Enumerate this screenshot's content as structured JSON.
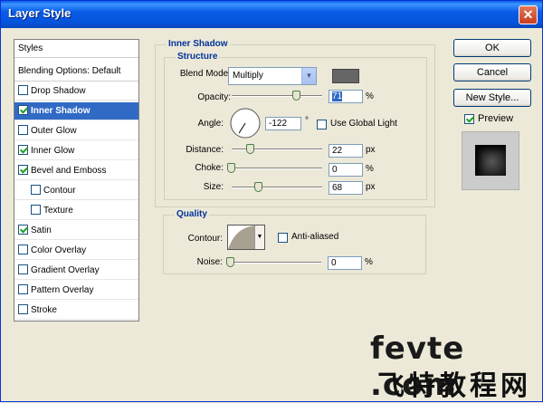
{
  "window": {
    "title": "Layer Style",
    "close_glyph": "✕"
  },
  "styles_panel": {
    "header": "Styles",
    "blending": "Blending Options: Default",
    "items": [
      {
        "label": "Drop Shadow",
        "checked": false,
        "selected": false,
        "indent": false
      },
      {
        "label": "Inner Shadow",
        "checked": true,
        "selected": true,
        "indent": false
      },
      {
        "label": "Outer Glow",
        "checked": false,
        "selected": false,
        "indent": false
      },
      {
        "label": "Inner Glow",
        "checked": true,
        "selected": false,
        "indent": false
      },
      {
        "label": "Bevel and Emboss",
        "checked": true,
        "selected": false,
        "indent": false
      },
      {
        "label": "Contour",
        "checked": false,
        "selected": false,
        "indent": true
      },
      {
        "label": "Texture",
        "checked": false,
        "selected": false,
        "indent": true
      },
      {
        "label": "Satin",
        "checked": true,
        "selected": false,
        "indent": false
      },
      {
        "label": "Color Overlay",
        "checked": false,
        "selected": false,
        "indent": false
      },
      {
        "label": "Gradient Overlay",
        "checked": false,
        "selected": false,
        "indent": false
      },
      {
        "label": "Pattern Overlay",
        "checked": false,
        "selected": false,
        "indent": false
      },
      {
        "label": "Stroke",
        "checked": false,
        "selected": false,
        "indent": false
      }
    ]
  },
  "inner_shadow": {
    "section_title": "Inner Shadow",
    "structure": {
      "title": "Structure",
      "blend_mode_label": "Blend Mode:",
      "blend_mode_value": "Multiply",
      "shadow_color": "#666666",
      "opacity_label": "Opacity:",
      "opacity_value": "71",
      "opacity_unit": "%",
      "angle_label": "Angle:",
      "angle_value": "-122",
      "angle_unit": "°",
      "use_global_light_label": "Use Global Light",
      "use_global_light": false,
      "distance_label": "Distance:",
      "distance_value": "22",
      "distance_unit": "px",
      "choke_label": "Choke:",
      "choke_value": "0",
      "choke_unit": "%",
      "size_label": "Size:",
      "size_value": "68",
      "size_unit": "px"
    },
    "quality": {
      "title": "Quality",
      "contour_label": "Contour:",
      "anti_aliased_label": "Anti-aliased",
      "anti_aliased": false,
      "noise_label": "Noise:",
      "noise_value": "0",
      "noise_unit": "%"
    }
  },
  "buttons": {
    "ok": "OK",
    "cancel": "Cancel",
    "new_style": "New Style...",
    "preview_label": "Preview",
    "preview_checked": true
  },
  "watermark": {
    "line1": "fevte .com",
    "line2": "飞特教程网"
  }
}
